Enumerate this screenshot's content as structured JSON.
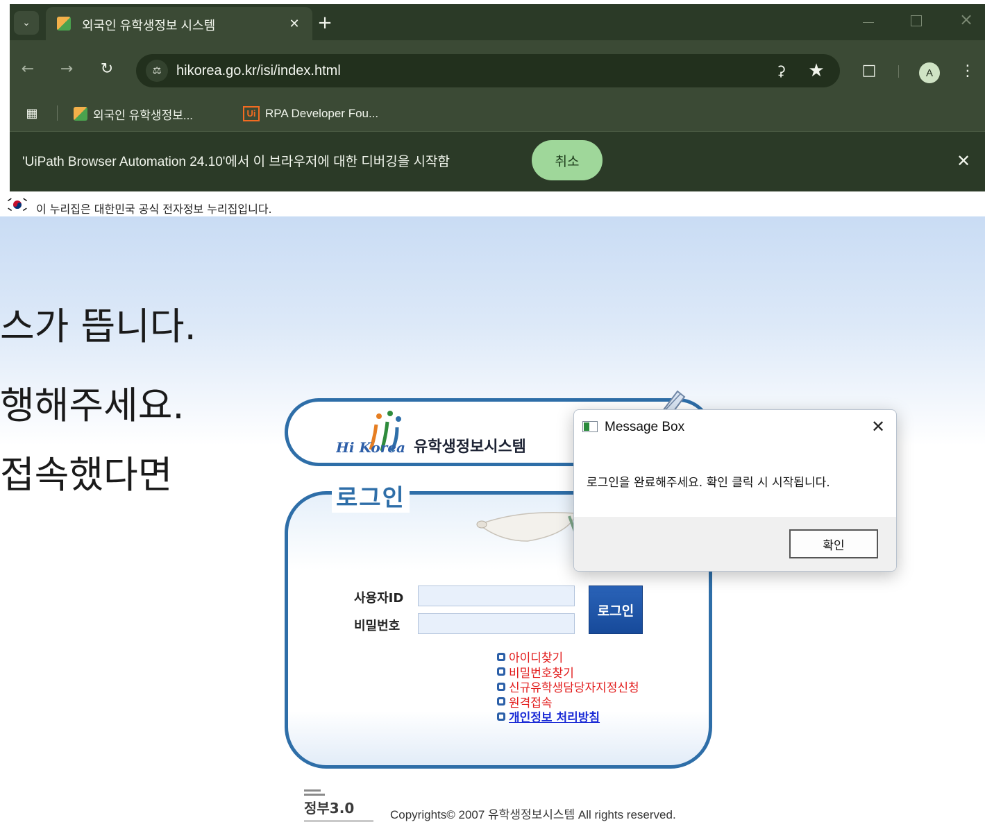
{
  "browser": {
    "tab": {
      "title": "외국인 유학생정보 시스템"
    },
    "address": {
      "url": "hikorea.go.kr/isi/index.html"
    },
    "profile_initial": "A",
    "bookmarks": [
      {
        "label": "외국인 유학생정보..."
      },
      {
        "label": "RPA Developer Fou...",
        "icon_text": "Ui"
      }
    ],
    "infobar": {
      "message": "'UiPath Browser Automation 24.10'에서 이 브라우저에 대한 디버깅을 시작함",
      "cancel_label": "취소"
    },
    "icons": {
      "tab_search": "chevron-down-icon",
      "close": "close-icon",
      "new_tab": "plus-icon",
      "back": "arrow-left-icon",
      "forward": "arrow-right-icon",
      "reload": "reload-icon",
      "site_info": "tune-icon",
      "password": "key-icon",
      "bookmark": "star-icon",
      "extensions": "puzzle-icon",
      "menu": "more-vertical-icon",
      "apps": "apps-grid-icon"
    },
    "colors": {
      "frame": "#2b3a27",
      "toolbar": "#3b4a35",
      "cancel_button": "#9fd79a"
    }
  },
  "page": {
    "gov_banner": "이 누리집은 대한민국 공식 전자정보 누리집입니다.",
    "slide_lines": [
      "스가 뜹니다.",
      "행해주세요.",
      "접속했다면"
    ],
    "login": {
      "brand": "Hi Korea",
      "system_title": "유학생정보시스템",
      "title": "로그인",
      "user_id_label": "사용자ID",
      "user_id_value": "",
      "password_label": "비밀번호",
      "password_value": "",
      "login_button": "로그인",
      "links": [
        {
          "label": "아이디찾기"
        },
        {
          "label": "비밀번호찾기"
        },
        {
          "label": "신규유학생담당자지정신청"
        },
        {
          "label": "원격접속"
        },
        {
          "label": "개인정보 처리방침"
        }
      ]
    },
    "footer": {
      "gov_logo_text": "정부3.0",
      "copyright": "Copyrights© 2007 유학생정보시스템 All rights reserved."
    },
    "colors": {
      "panel_border": "#2e6ea8",
      "link_red": "#e21b1b",
      "link_blue": "#1b2bd6",
      "login_button": "#1f56a8"
    }
  },
  "message_box": {
    "title": "Message Box",
    "text": "로그인을 완료해주세요. 확인 클릭 시 시작됩니다.",
    "ok_label": "확인"
  }
}
